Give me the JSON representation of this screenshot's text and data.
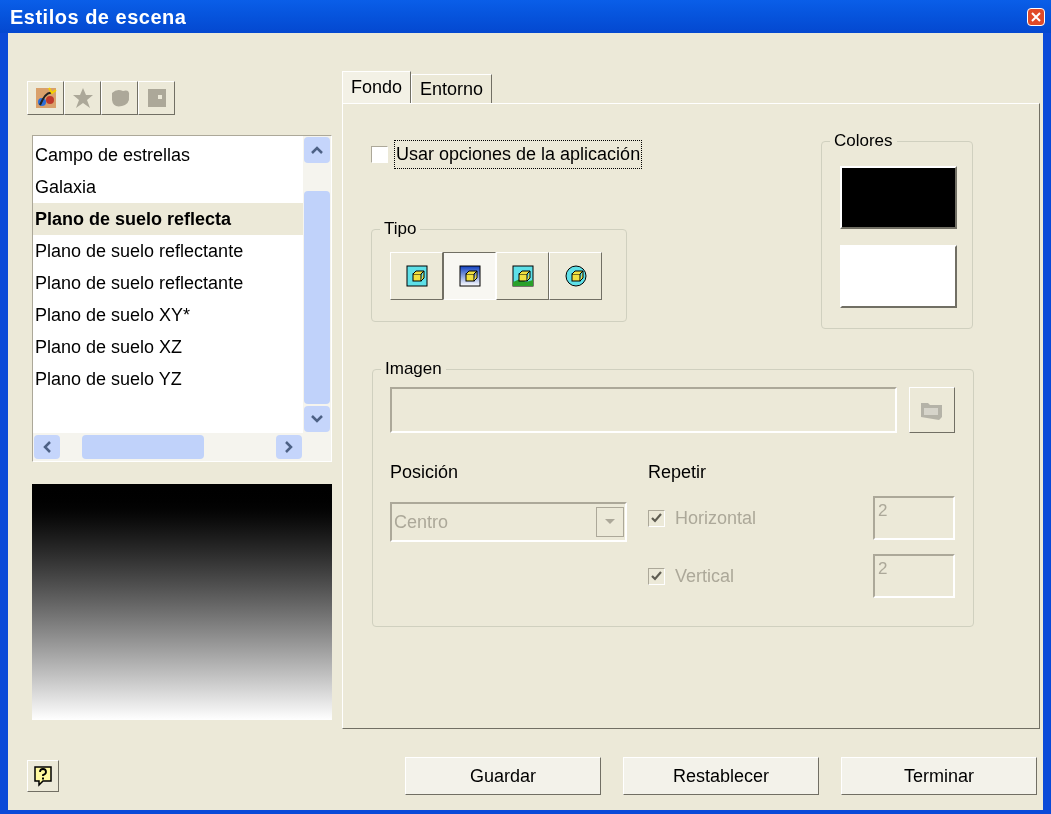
{
  "window": {
    "title": "Estilos de escena"
  },
  "toolbar": [
    {
      "kind": "new",
      "disabled": false
    },
    {
      "kind": "star",
      "disabled": true
    },
    {
      "kind": "blob",
      "disabled": true
    },
    {
      "kind": "square",
      "disabled": true
    }
  ],
  "styles": [
    {
      "label": "Campo de estrellas",
      "selected": false
    },
    {
      "label": "Galaxia",
      "selected": false
    },
    {
      "label": "Plano de suelo reflecta",
      "selected": true
    },
    {
      "label": "Plano de suelo reflectante",
      "selected": false
    },
    {
      "label": "Plano de suelo reflectante",
      "selected": false
    },
    {
      "label": "Plano de suelo XY*",
      "selected": false
    },
    {
      "label": "Plano de suelo XZ",
      "selected": false
    },
    {
      "label": "Plano de suelo YZ",
      "selected": false
    }
  ],
  "tabs": [
    {
      "label": "Fondo",
      "selected": true
    },
    {
      "label": "Entorno",
      "selected": false
    }
  ],
  "use_app_options": {
    "label": "Usar opciones de la aplicación",
    "checked": false
  },
  "tipo": {
    "title": "Tipo",
    "options": [
      {
        "kind": "solid",
        "selected": false
      },
      {
        "kind": "gradient",
        "selected": true
      },
      {
        "kind": "image",
        "selected": false
      },
      {
        "kind": "sphere",
        "selected": false
      }
    ]
  },
  "colores": {
    "title": "Colores",
    "swatches": [
      {
        "color": "#000000"
      },
      {
        "color": "#ffffff"
      }
    ]
  },
  "imagen": {
    "title": "Imagen",
    "disabled": true,
    "position": {
      "label": "Posición",
      "value": "Centro"
    },
    "repeat": {
      "label": "Repetir",
      "items": [
        {
          "label": "Horizontal",
          "checked": true,
          "value": "2"
        },
        {
          "label": "Vertical",
          "checked": true,
          "value": "2"
        }
      ]
    }
  },
  "buttons": [
    "Guardar",
    "Restablecer",
    "Terminar"
  ]
}
